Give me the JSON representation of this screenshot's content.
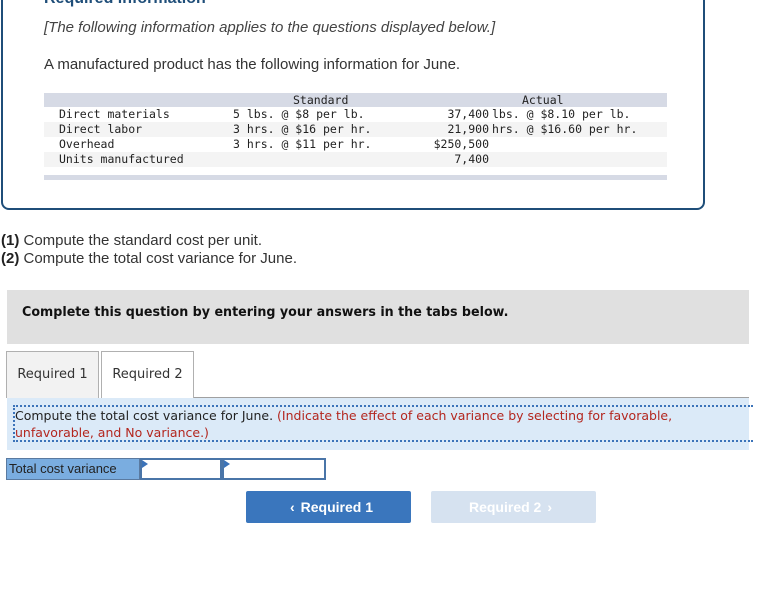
{
  "info": {
    "title": "Required information",
    "intro": "[The following information applies to the questions displayed below.]",
    "description": "A manufactured product has the following information for June."
  },
  "table": {
    "headers": {
      "standard": "Standard",
      "actual": "Actual"
    },
    "rows": [
      {
        "label": "Direct materials",
        "standard": "5 lbs. @ $8 per lb.",
        "actual_num": "37,400",
        "actual_unit": "lbs. @ $8.10 per lb."
      },
      {
        "label": "Direct labor",
        "standard": "3 hrs. @ $16 per hr.",
        "actual_num": "21,900",
        "actual_unit": "hrs. @ $16.60 per hr."
      },
      {
        "label": "Overhead",
        "standard": "3 hrs. @ $11 per hr.",
        "actual_num": "$250,500",
        "actual_unit": ""
      },
      {
        "label": "Units manufactured",
        "standard": "",
        "actual_num": "7,400",
        "actual_unit": ""
      }
    ]
  },
  "questions": [
    {
      "num": "(1)",
      "text": " Compute the standard cost per unit."
    },
    {
      "num": "(2)",
      "text": " Compute the total cost variance for June."
    }
  ],
  "banner": "Complete this question by entering your answers in the tabs below.",
  "tabs": [
    {
      "label": "Required 1",
      "active": false
    },
    {
      "label": "Required 2",
      "active": true
    }
  ],
  "instruction": {
    "main": "Compute the total cost variance for June. ",
    "note_line1": "(Indicate the effect of each variance by selecting for favorable, unfavorable, and No variance.)",
    "note_line2": "variance.)"
  },
  "answer": {
    "label": "Total cost variance",
    "amount_value": "",
    "effect_value": ""
  },
  "nav": {
    "prev_label": "Required 1",
    "next_label": "Required 2",
    "prev_icon": "‹",
    "next_icon": "›"
  }
}
